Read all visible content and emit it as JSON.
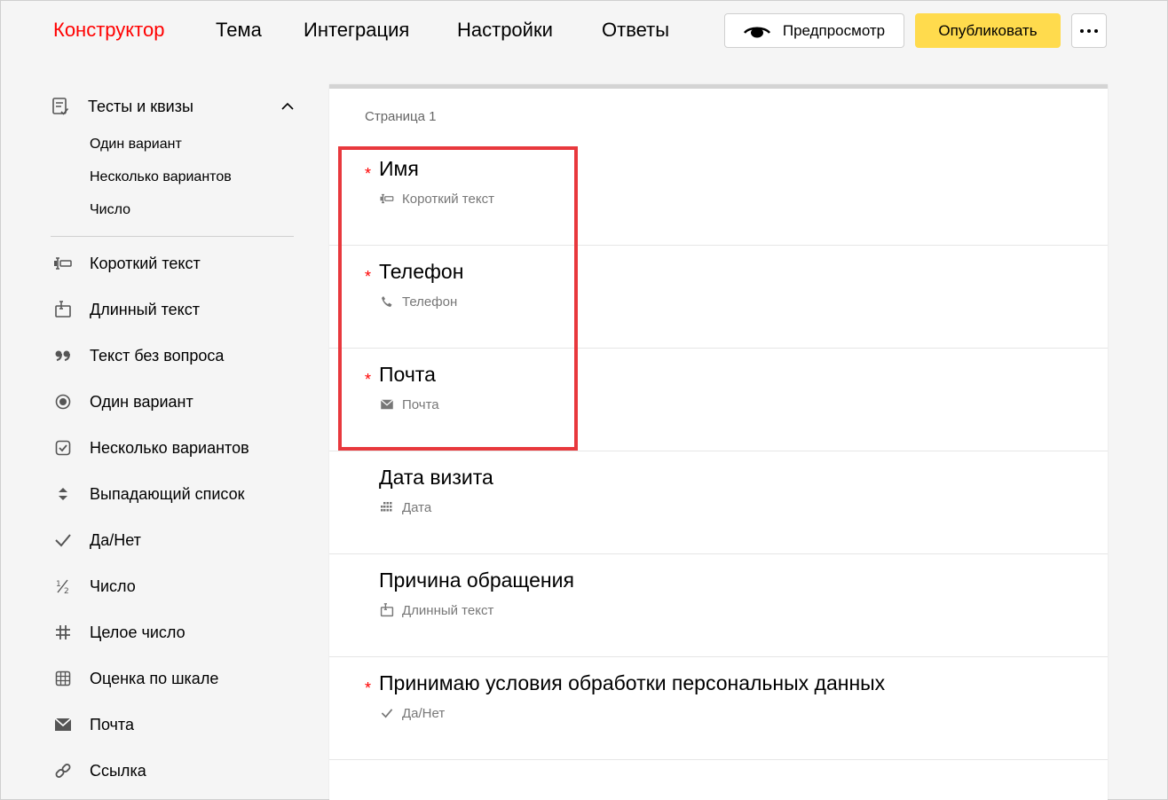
{
  "nav": {
    "tabs": [
      {
        "label": "Конструктор",
        "active": true
      },
      {
        "label": "Тема"
      },
      {
        "label": "Интеграция"
      },
      {
        "label": "Настройки"
      },
      {
        "label": "Ответы"
      }
    ],
    "preview_label": "Предпросмотр",
    "publish_label": "Опубликовать"
  },
  "sidebar": {
    "group": {
      "label": "Тесты и квизы",
      "items": [
        "Один вариант",
        "Несколько вариантов",
        "Число"
      ]
    },
    "tools": [
      {
        "label": "Короткий текст",
        "icon": "short-text-icon"
      },
      {
        "label": "Длинный текст",
        "icon": "long-text-icon"
      },
      {
        "label": "Текст без вопроса",
        "icon": "quote-icon"
      },
      {
        "label": "Один вариант",
        "icon": "radio-icon"
      },
      {
        "label": "Несколько вариантов",
        "icon": "checkbox-icon"
      },
      {
        "label": "Выпадающий список",
        "icon": "dropdown-icon"
      },
      {
        "label": "Да/Нет",
        "icon": "check-icon"
      },
      {
        "label": "Число",
        "icon": "fraction-icon"
      },
      {
        "label": "Целое число",
        "icon": "hash-icon"
      },
      {
        "label": "Оценка по шкале",
        "icon": "grid-icon"
      },
      {
        "label": "Почта",
        "icon": "mail-icon"
      },
      {
        "label": "Ссылка",
        "icon": "link-icon"
      }
    ]
  },
  "form": {
    "page_label": "Страница 1",
    "questions": [
      {
        "title": "Имя",
        "type": "Короткий текст",
        "required": true,
        "icon": "short-text-icon"
      },
      {
        "title": "Телефон",
        "type": "Телефон",
        "required": true,
        "icon": "phone-icon"
      },
      {
        "title": "Почта",
        "type": "Почта",
        "required": true,
        "icon": "mail-icon"
      },
      {
        "title": "Дата визита",
        "type": "Дата",
        "required": false,
        "icon": "calendar-icon"
      },
      {
        "title": "Причина обращения",
        "type": "Длинный текст",
        "required": false,
        "icon": "long-text-icon"
      },
      {
        "title": "Принимаю условия обработки персональных данных",
        "type": "Да/Нет",
        "required": true,
        "icon": "check-icon"
      }
    ],
    "required_mark": "*"
  },
  "colors": {
    "active_tab": "#ff0000",
    "publish_bg": "#ffdb4d",
    "highlight": "#e8383d",
    "required": "#ff0000"
  }
}
